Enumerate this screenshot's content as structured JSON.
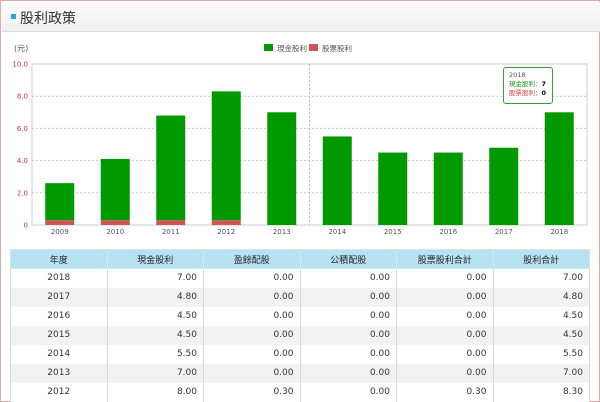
{
  "header": {
    "title": "股利政策"
  },
  "colors": {
    "cash": "#009a00",
    "stock": "#cc5555",
    "tooltip_border": "#2fa52f",
    "table_header_bg": "#b7e2f2"
  },
  "chart_data": {
    "type": "bar",
    "stacked": true,
    "unit_label": "(元)",
    "categories": [
      "2009",
      "2010",
      "2011",
      "2012",
      "2013",
      "2014",
      "2015",
      "2016",
      "2017",
      "2018"
    ],
    "series": [
      {
        "name": "現金股利",
        "values": [
          2.3,
          3.8,
          6.5,
          8.0,
          7.0,
          5.5,
          4.5,
          4.5,
          4.8,
          7.0
        ]
      },
      {
        "name": "股票股利",
        "values": [
          0.3,
          0.3,
          0.3,
          0.3,
          0,
          0,
          0,
          0,
          0,
          0
        ]
      }
    ],
    "ylim": [
      0,
      10
    ],
    "yticks": [
      "0",
      "2.0",
      "4.0",
      "6.0",
      "8.0",
      "10.0"
    ],
    "grid": true,
    "legend_position": "top-center",
    "tooltip": {
      "year": "2018",
      "cash_label": "現金股利：",
      "cash_value": "7",
      "stock_label": "股票股利：",
      "stock_value": "0"
    }
  },
  "table": {
    "headers": [
      "年度",
      "現金股利",
      "盈餘配股",
      "公積配股",
      "股票股利合計",
      "股利合計"
    ],
    "rows": [
      [
        "2018",
        "7.00",
        "0.00",
        "0.00",
        "0.00",
        "7.00"
      ],
      [
        "2017",
        "4.80",
        "0.00",
        "0.00",
        "0.00",
        "4.80"
      ],
      [
        "2016",
        "4.50",
        "0.00",
        "0.00",
        "0.00",
        "4.50"
      ],
      [
        "2015",
        "4.50",
        "0.00",
        "0.00",
        "0.00",
        "4.50"
      ],
      [
        "2014",
        "5.50",
        "0.00",
        "0.00",
        "0.00",
        "5.50"
      ],
      [
        "2013",
        "7.00",
        "0.00",
        "0.00",
        "0.00",
        "7.00"
      ],
      [
        "2012",
        "8.00",
        "0.30",
        "0.00",
        "0.30",
        "8.30"
      ]
    ]
  }
}
